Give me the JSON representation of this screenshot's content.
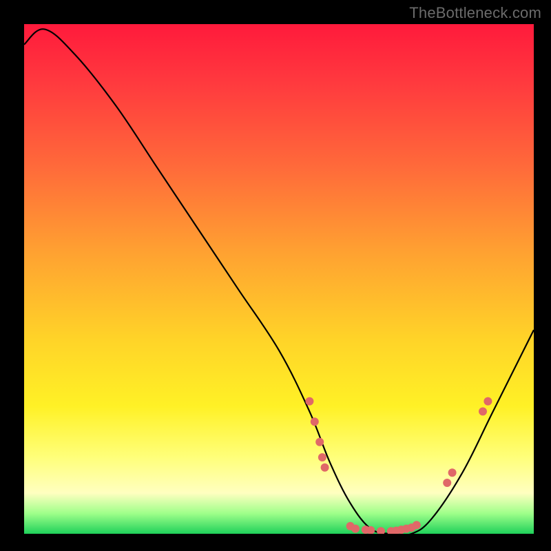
{
  "watermark": "TheBottleneck.com",
  "chart_data": {
    "type": "line",
    "title": "",
    "xlabel": "",
    "ylabel": "",
    "xlim": [
      0,
      100
    ],
    "ylim": [
      0,
      100
    ],
    "series": [
      {
        "name": "curve",
        "x": [
          0,
          4,
          10,
          18,
          26,
          34,
          42,
          50,
          56,
          60,
          64,
          68,
          72,
          76,
          80,
          86,
          92,
          100
        ],
        "y": [
          96,
          99,
          94,
          84,
          72,
          60,
          48,
          36,
          24,
          14,
          6,
          1,
          0,
          0,
          3,
          12,
          24,
          40
        ]
      }
    ],
    "data_points": [
      {
        "x": 56,
        "y": 26
      },
      {
        "x": 57,
        "y": 22
      },
      {
        "x": 58,
        "y": 18
      },
      {
        "x": 58.5,
        "y": 15
      },
      {
        "x": 59,
        "y": 13
      },
      {
        "x": 64,
        "y": 1.5
      },
      {
        "x": 65,
        "y": 1
      },
      {
        "x": 67,
        "y": 0.8
      },
      {
        "x": 68,
        "y": 0.7
      },
      {
        "x": 70,
        "y": 0.5
      },
      {
        "x": 72,
        "y": 0.5
      },
      {
        "x": 73,
        "y": 0.6
      },
      {
        "x": 74,
        "y": 0.8
      },
      {
        "x": 75,
        "y": 1
      },
      {
        "x": 76,
        "y": 1.2
      },
      {
        "x": 77,
        "y": 1.7
      },
      {
        "x": 83,
        "y": 10
      },
      {
        "x": 84,
        "y": 12
      },
      {
        "x": 90,
        "y": 24
      },
      {
        "x": 91,
        "y": 26
      }
    ],
    "colors": {
      "curve": "#000000",
      "points": "#e06868"
    }
  }
}
